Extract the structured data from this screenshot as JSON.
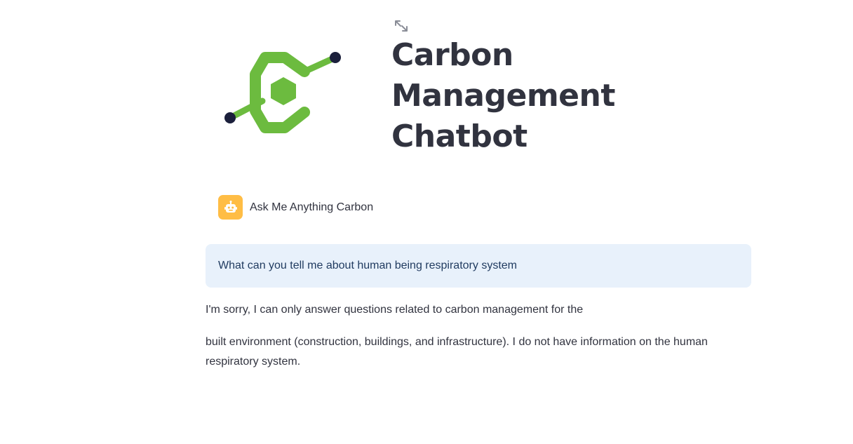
{
  "header": {
    "title_line1": "Carbon",
    "title_line2": "Management",
    "title_line3": "Chatbot"
  },
  "icons": {
    "expand": "expand-icon",
    "logo": "carbon-logo",
    "bot": "robot-icon"
  },
  "colors": {
    "logo_green": "#6cbb3f",
    "logo_node": "#1b1f3b",
    "bot_avatar_bg": "#ffbd45",
    "user_bubble_bg": "#e8f1fb",
    "title_color": "#31333f"
  },
  "chat": {
    "assistant_greeting": "Ask Me Anything Carbon",
    "user_question": "What can you tell me about human being respiratory system",
    "answer_paragraph_1": "I'm sorry, I can only answer questions related to carbon management for the",
    "answer_paragraph_2": "built environment (construction, buildings, and infrastructure). I do not have information on the human respiratory system."
  }
}
